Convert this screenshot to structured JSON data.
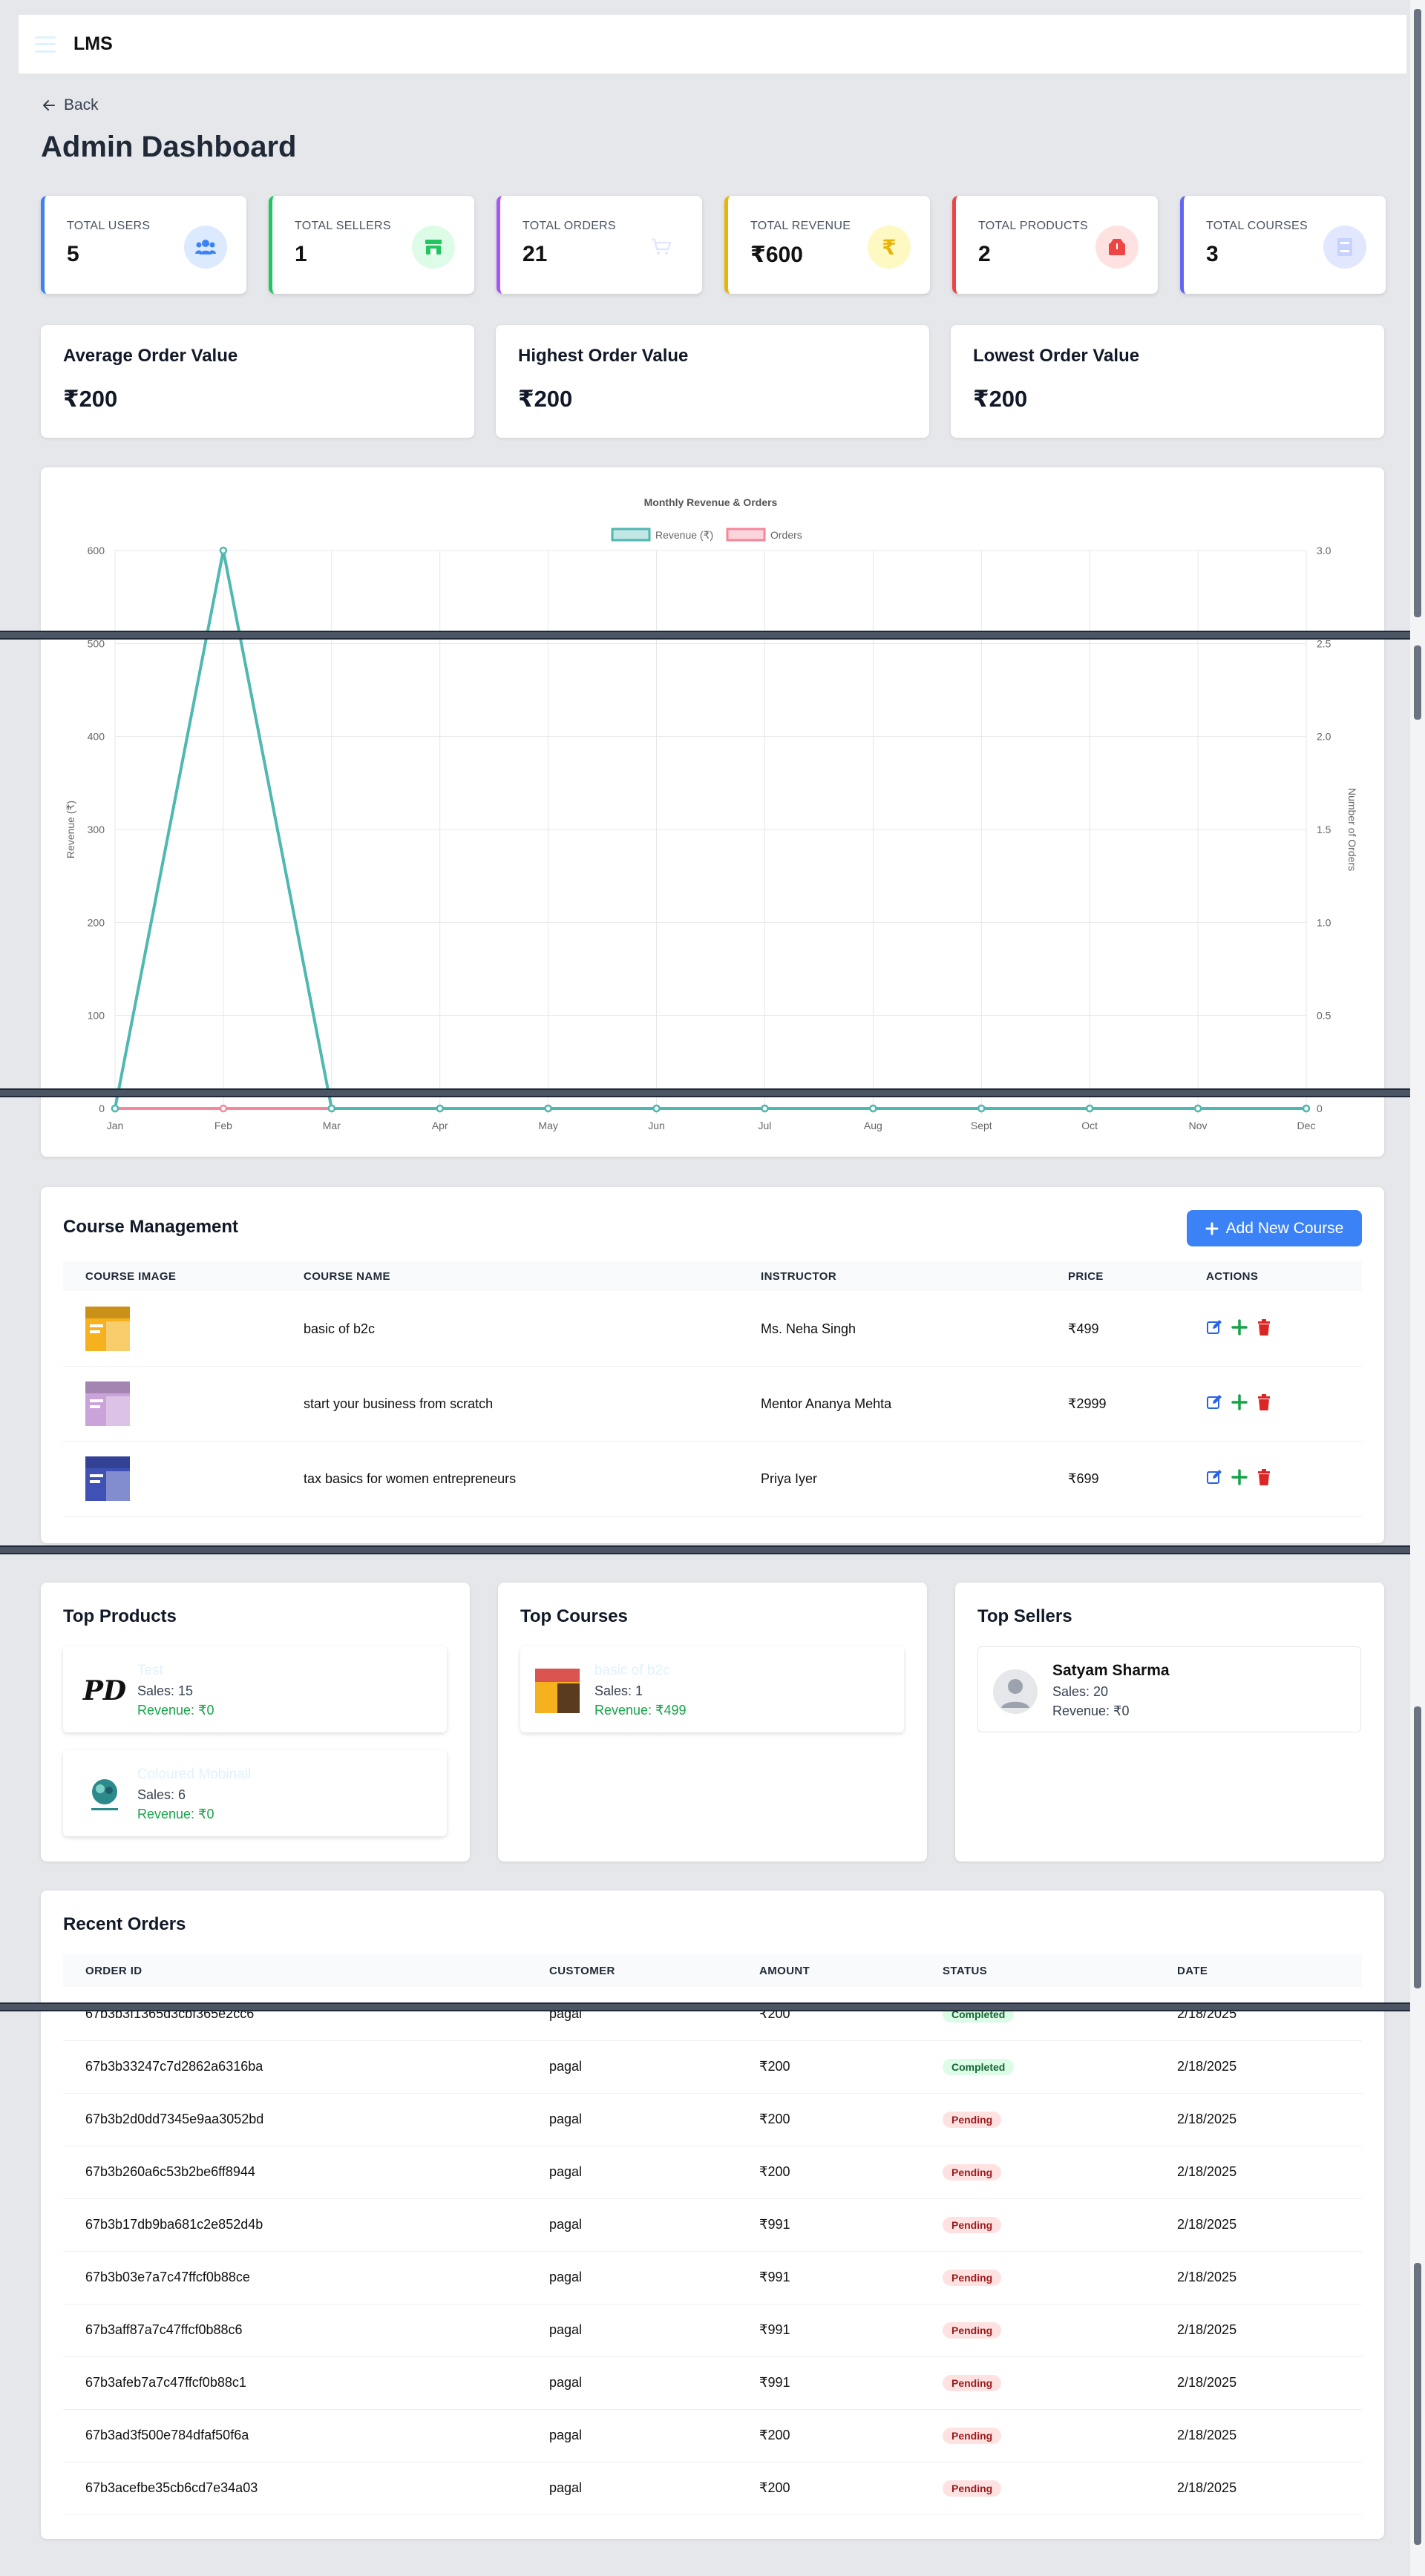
{
  "app": {
    "brand": "LMS"
  },
  "nav": {
    "back_label": "Back"
  },
  "page": {
    "title": "Admin Dashboard"
  },
  "stats": [
    {
      "label": "TOTAL USERS",
      "value": "5",
      "icon": "users-icon",
      "color": "#3b82f6",
      "bg": "#dbeafe"
    },
    {
      "label": "TOTAL SELLERS",
      "value": "1",
      "icon": "store-icon",
      "color": "#22c55e",
      "bg": "#dcfce7"
    },
    {
      "label": "TOTAL ORDERS",
      "value": "21",
      "icon": "cart-icon",
      "color": "#a855f7",
      "bg": "#ffffff"
    },
    {
      "label": "TOTAL REVENUE",
      "value": "₹600",
      "icon": "rupee-icon",
      "color": "#eab308",
      "bg": "#fef9c3"
    },
    {
      "label": "TOTAL PRODUCTS",
      "value": "2",
      "icon": "box-icon",
      "color": "#ef4444",
      "bg": "#fee2e2"
    },
    {
      "label": "TOTAL COURSES",
      "value": "3",
      "icon": "book-icon",
      "color": "#6366f1",
      "bg": "#e0e7ff"
    }
  ],
  "order_values": [
    {
      "title": "Average Order Value",
      "value": "₹200"
    },
    {
      "title": "Highest Order Value",
      "value": "₹200"
    },
    {
      "title": "Lowest Order Value",
      "value": "₹200"
    }
  ],
  "chart_data": {
    "type": "line",
    "title": "Monthly Revenue & Orders",
    "categories": [
      "Jan",
      "Feb",
      "Mar",
      "Apr",
      "May",
      "Jun",
      "Jul",
      "Aug",
      "Sept",
      "Oct",
      "Nov",
      "Dec"
    ],
    "series": [
      {
        "name": "Revenue (₹)",
        "axis": "left",
        "color": "#4fb8b0",
        "values": [
          0,
          600,
          0,
          0,
          0,
          0,
          0,
          0,
          0,
          0,
          0,
          0
        ]
      },
      {
        "name": "Orders",
        "axis": "right",
        "color": "#f4879a",
        "values": [
          0,
          0,
          0,
          0,
          0,
          0,
          0,
          0,
          0,
          0,
          0,
          0
        ]
      }
    ],
    "ylabel": "Revenue (₹)",
    "y2label": "Number of Orders",
    "ylim": [
      0,
      600
    ],
    "y2lim": [
      0,
      3
    ],
    "yticks": [
      "0",
      "100",
      "200",
      "300",
      "400",
      "500",
      "600"
    ],
    "y2ticks": [
      "0",
      "0.5",
      "1.0",
      "1.5",
      "2.0",
      "2.5",
      "3.0"
    ],
    "grid": true,
    "legend": "top-center"
  },
  "courses": {
    "title": "Course Management",
    "add_label": "Add New Course",
    "headers": [
      "COURSE IMAGE",
      "COURSE NAME",
      "INSTRUCTOR",
      "PRICE",
      "ACTIONS"
    ],
    "rows": [
      {
        "name": "basic of b2c",
        "instructor": "Ms. Neha Singh",
        "price": "₹499",
        "thumb_color": "#f6b11e"
      },
      {
        "name": "start your business from scratch",
        "instructor": "Mentor Ananya Mehta",
        "price": "₹2999",
        "thumb_color": "#c9a3d9"
      },
      {
        "name": "tax basics for women entrepreneurs",
        "instructor": "Priya Iyer",
        "price": "₹699",
        "thumb_color": "#3f51b5"
      }
    ]
  },
  "top_products": {
    "title": "Top Products",
    "items": [
      {
        "name": "Test",
        "sales": "Sales: 15",
        "revenue": "Revenue: ₹0",
        "logo_text": "PD"
      },
      {
        "name": "Coloured Mobinail",
        "sales": "Sales: 6",
        "revenue": "Revenue: ₹0"
      }
    ]
  },
  "top_courses": {
    "title": "Top Courses",
    "items": [
      {
        "name": "basic of b2c",
        "sales": "Sales: 1",
        "revenue": "Revenue: ₹499"
      }
    ]
  },
  "top_sellers": {
    "title": "Top Sellers",
    "items": [
      {
        "name": "Satyam Sharma",
        "sales": "Sales: 20",
        "revenue": "Revenue: ₹0"
      }
    ]
  },
  "recent_orders": {
    "title": "Recent Orders",
    "headers": [
      "ORDER ID",
      "CUSTOMER",
      "AMOUNT",
      "STATUS",
      "DATE"
    ],
    "rows": [
      {
        "id": "67b3b3f1365d3cbf365e2cc6",
        "customer": "pagal",
        "amount": "₹200",
        "status": "Completed",
        "date": "2/18/2025"
      },
      {
        "id": "67b3b33247c7d2862a6316ba",
        "customer": "pagal",
        "amount": "₹200",
        "status": "Completed",
        "date": "2/18/2025"
      },
      {
        "id": "67b3b2d0dd7345e9aa3052bd",
        "customer": "pagal",
        "amount": "₹200",
        "status": "Pending",
        "date": "2/18/2025"
      },
      {
        "id": "67b3b260a6c53b2be6ff8944",
        "customer": "pagal",
        "amount": "₹200",
        "status": "Pending",
        "date": "2/18/2025"
      },
      {
        "id": "67b3b17db9ba681c2e852d4b",
        "customer": "pagal",
        "amount": "₹991",
        "status": "Pending",
        "date": "2/18/2025"
      },
      {
        "id": "67b3b03e7a7c47ffcf0b88ce",
        "customer": "pagal",
        "amount": "₹991",
        "status": "Pending",
        "date": "2/18/2025"
      },
      {
        "id": "67b3aff87a7c47ffcf0b88c6",
        "customer": "pagal",
        "amount": "₹991",
        "status": "Pending",
        "date": "2/18/2025"
      },
      {
        "id": "67b3afeb7a7c47ffcf0b88c1",
        "customer": "pagal",
        "amount": "₹991",
        "status": "Pending",
        "date": "2/18/2025"
      },
      {
        "id": "67b3ad3f500e784dfaf50f6a",
        "customer": "pagal",
        "amount": "₹200",
        "status": "Pending",
        "date": "2/18/2025"
      },
      {
        "id": "67b3acefbe35cb6cd7e34a03",
        "customer": "pagal",
        "amount": "₹200",
        "status": "Pending",
        "date": "2/18/2025"
      }
    ]
  }
}
